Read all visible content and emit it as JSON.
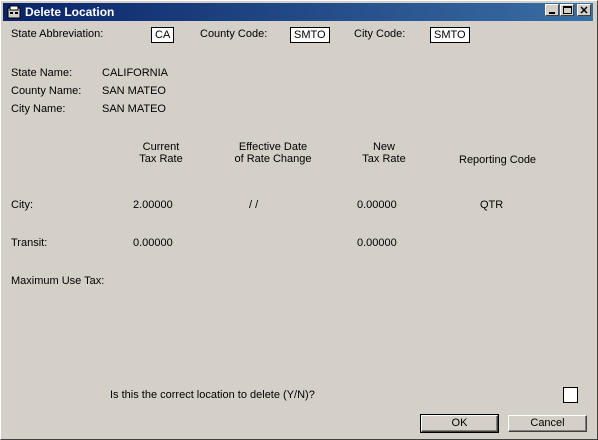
{
  "window": {
    "title": "Delete Location"
  },
  "labels": {
    "state_abbrev": "State Abbreviation:",
    "county_code": "County Code:",
    "city_code": "City Code:",
    "state_name": "State Name:",
    "county_name": "County Name:",
    "city_name": "City Name:"
  },
  "values": {
    "state_abbrev": "CA",
    "county_code": "SMTO",
    "city_code": "SMTO",
    "state_name": "CALIFORNIA",
    "county_name": "SAN MATEO",
    "city_name": "SAN MATEO"
  },
  "columns": {
    "current_line1": "Current",
    "current_line2": "Tax Rate",
    "effective_line1": "Effective Date",
    "effective_line2": "of Rate Change",
    "new_line1": "New",
    "new_line2": "Tax Rate",
    "reporting": "Reporting Code"
  },
  "rows": {
    "city": {
      "label": "City:",
      "current": "2.00000",
      "effective": "/  /",
      "new": "0.00000",
      "reporting": "QTR"
    },
    "transit": {
      "label": "Transit:",
      "current": "0.00000",
      "new": "0.00000"
    },
    "max_use": {
      "label": "Maximum Use Tax:"
    }
  },
  "confirm": {
    "question": "Is this the correct location to delete (Y/N)?",
    "value": ""
  },
  "buttons": {
    "ok": "OK",
    "cancel": "Cancel"
  }
}
